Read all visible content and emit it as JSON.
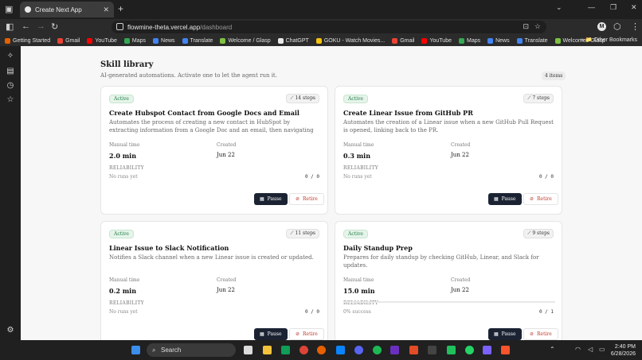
{
  "browser": {
    "tab_title": "Create Next App",
    "url_host": "flowmine-theta.vercel.app",
    "url_path": "/dashboard",
    "bookmarks": [
      {
        "label": "Getting Started",
        "icon": "firefox-icon",
        "color": "#e66000"
      },
      {
        "label": "Gmail",
        "icon": "gmail-icon",
        "color": "#ea4335"
      },
      {
        "label": "YouTube",
        "icon": "youtube-icon",
        "color": "#ff0000"
      },
      {
        "label": "Maps",
        "icon": "maps-icon",
        "color": "#34a853"
      },
      {
        "label": "News",
        "icon": "news-icon",
        "color": "#4285f4"
      },
      {
        "label": "Translate",
        "icon": "translate-icon",
        "color": "#4285f4"
      },
      {
        "label": "Welcome / Glasp",
        "icon": "glasp-icon",
        "color": "#7dc242"
      },
      {
        "label": "ChatGPT",
        "icon": "chatgpt-icon",
        "color": "#e8e8e8"
      },
      {
        "label": "GOKU - Watch Movies...",
        "icon": "goku-icon",
        "color": "#f4c20d"
      },
      {
        "label": "Gmail",
        "icon": "gmail-icon",
        "color": "#ea4335"
      },
      {
        "label": "YouTube",
        "icon": "youtube-icon",
        "color": "#ff0000"
      },
      {
        "label": "Maps",
        "icon": "maps-icon",
        "color": "#34a853"
      },
      {
        "label": "News",
        "icon": "news-icon",
        "color": "#4285f4"
      },
      {
        "label": "Translate",
        "icon": "translate-icon",
        "color": "#4285f4"
      },
      {
        "label": "Welcome / Glasp",
        "icon": "glasp-icon",
        "color": "#7dc242"
      }
    ],
    "other_bookmarks": "Other Bookmarks",
    "profile_initial": "M"
  },
  "page": {
    "title": "Skill library",
    "subtitle": "AI-generated automations. Activate one to let the agent run it.",
    "count_badge": "4 items"
  },
  "labels": {
    "manual_time": "Manual time",
    "created": "Created",
    "reliability": "RELIABILITY",
    "pause": "Pause",
    "retire": "Retire"
  },
  "cards": [
    {
      "status": "Active",
      "steps": "14 steps",
      "title": "Create Hubspot Contact from Google Docs and Email",
      "description": "Automates the process of creating a new contact in HubSpot by extracting information from a Google Doc and an email, then navigating to HubSpot to fill out the contact…",
      "manual_time": "2.0 min",
      "created": "Jun 22",
      "reliability_text": "No runs yet",
      "runs": "0 / 0",
      "success_fraction": 0
    },
    {
      "status": "Active",
      "steps": "7 steps",
      "title": "Create Linear Issue from GitHub PR",
      "description": "Automates the creation of a Linear issue when a new GitHub Pull Request is opened, linking back to the PR.",
      "manual_time": "0.3 min",
      "created": "Jun 22",
      "reliability_text": "No runs yet",
      "runs": "0 / 0",
      "success_fraction": 0
    },
    {
      "status": "Active",
      "steps": "11 steps",
      "title": "Linear Issue to Slack Notification",
      "description": "Notifies a Slack channel when a new Linear issue is created or updated.",
      "manual_time": "0.2 min",
      "created": "Jun 22",
      "reliability_text": "No runs yet",
      "runs": "0 / 0",
      "success_fraction": 0
    },
    {
      "status": "Active",
      "steps": "9 steps",
      "title": "Daily Standup Prep",
      "description": "Prepares for daily standup by checking GitHub, Linear, and Slack for updates.",
      "manual_time": "15.0 min",
      "created": "Jun 22",
      "reliability_text": "0% success",
      "runs": "0 / 1",
      "success_fraction": 0
    }
  ],
  "taskbar": {
    "search_label": "Search",
    "time": "2:40 PM",
    "date": "6/28/2026"
  },
  "colors": {
    "pause_button": "#1b2333",
    "active_badge": "#1e7c44",
    "retire_text": "#c0392b"
  }
}
